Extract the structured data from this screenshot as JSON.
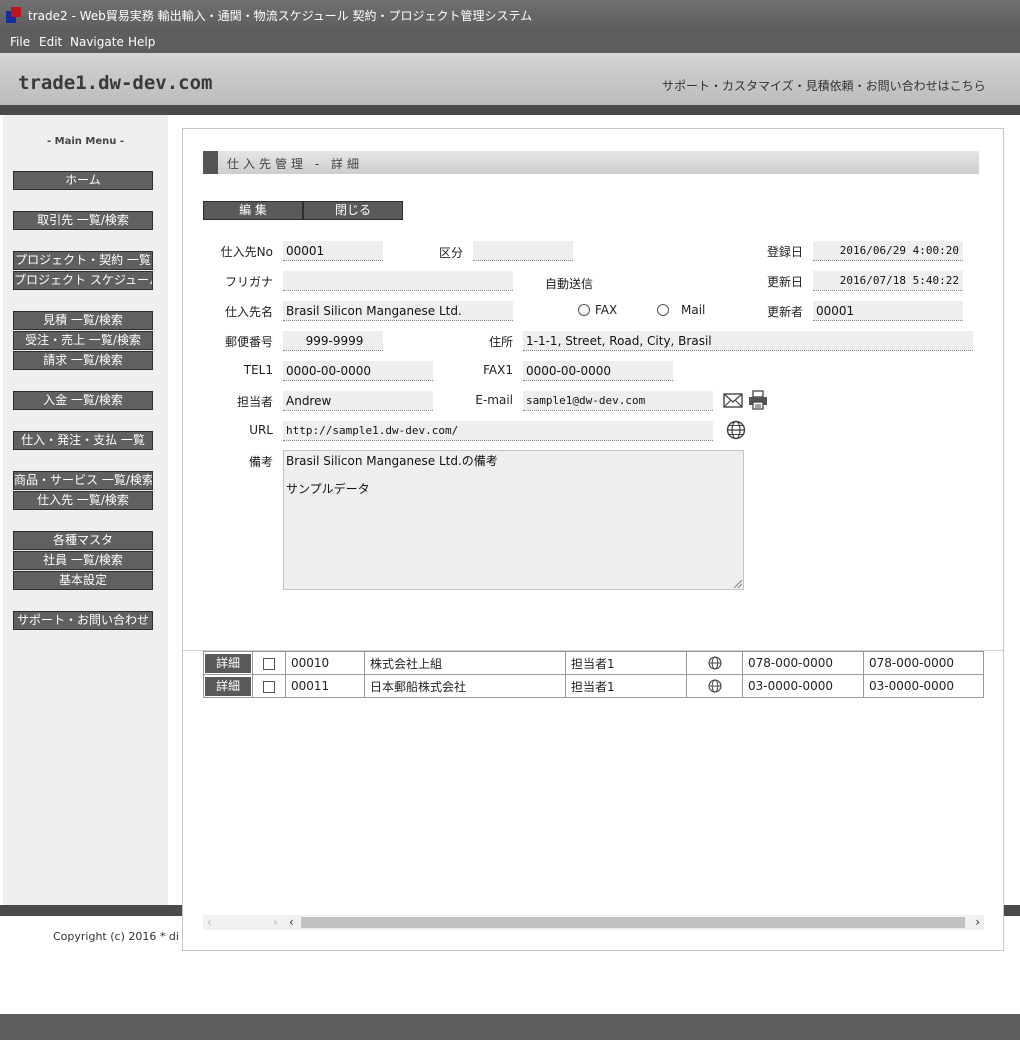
{
  "window": {
    "title": "trade2 - Web貿易実務 輸出輸入・通関・物流スケジュール 契約・プロジェクト管理システム",
    "menu": [
      "File",
      "Edit",
      "Navigate",
      "Help"
    ]
  },
  "header": {
    "brand": "trade1.dw-dev.com",
    "support_link": "サポート・カスタマイズ・見積依頼・お問い合わせはこちら"
  },
  "sidebar": {
    "title": "- Main Menu -",
    "items": [
      "ホーム",
      "取引先 一覧/検索",
      "プロジェクト・契約 一覧",
      "プロジェクト スケジュール",
      "見積 一覧/検索",
      "受注・売上 一覧/検索",
      "請求 一覧/検索",
      "入金 一覧/検索",
      "仕入・発注・支払 一覧",
      "商品・サービス 一覧/検索",
      "仕入先 一覧/検索",
      "各種マスタ",
      "社員 一覧/検索",
      "基本設定",
      "サポート・お問い合わせ"
    ]
  },
  "page": {
    "section_title": "仕入先管理 - 詳細",
    "buttons": {
      "edit": "編 集",
      "close": "閉じる"
    }
  },
  "form": {
    "supplier_no": {
      "label": "仕入先No",
      "value": "00001"
    },
    "category": {
      "label": "区分",
      "value": ""
    },
    "registered": {
      "label": "登録日",
      "value": "2016/06/29 4:00:20"
    },
    "furigana": {
      "label": "フリガナ",
      "value": ""
    },
    "auto_send": {
      "label": "自動送信",
      "options": [
        "FAX",
        "Mail"
      ]
    },
    "updated": {
      "label": "更新日",
      "value": "2016/07/18 5:40:22"
    },
    "supplier_name": {
      "label": "仕入先名",
      "value": "Brasil Silicon Manganese Ltd."
    },
    "updater": {
      "label": "更新者",
      "value": "00001"
    },
    "postal": {
      "label": "郵便番号",
      "value": "999-9999"
    },
    "address": {
      "label": "住所",
      "value": "1-1-1, Street, Road, City, Brasil"
    },
    "tel1": {
      "label": "TEL1",
      "value": "0000-00-0000"
    },
    "fax1": {
      "label": "FAX1",
      "value": "0000-00-0000"
    },
    "contact": {
      "label": "担当者",
      "value": "Andrew"
    },
    "email": {
      "label": "E-mail",
      "value": "sample1@dw-dev.com"
    },
    "url": {
      "label": "URL",
      "value": "http://sample1.dw-dev.com/"
    },
    "memo": {
      "label": "備考",
      "line1": "Brasil Silicon Manganese Ltd.の備考",
      "line2": "サンプルデータ"
    }
  },
  "icons": {
    "mail": "envelope-icon",
    "print": "printer-icon",
    "web": "globe-icon"
  },
  "table": {
    "rows": [
      {
        "btn": "詳細",
        "code": "00010",
        "name": "株式会社上組",
        "person": "担当者1",
        "tel": "078-000-0000",
        "fax": "078-000-0000"
      },
      {
        "btn": "詳細",
        "code": "00011",
        "name": "日本郵船株式会社",
        "person": "担当者1",
        "tel": "03-0000-0000",
        "fax": "03-0000-0000"
      }
    ]
  },
  "footer": {
    "copyright": "Copyright (c) 2016 * di"
  },
  "colors": {
    "button": "#5a5a5a",
    "field_bg": "#eeeeee",
    "band": "#4a4a4a"
  }
}
